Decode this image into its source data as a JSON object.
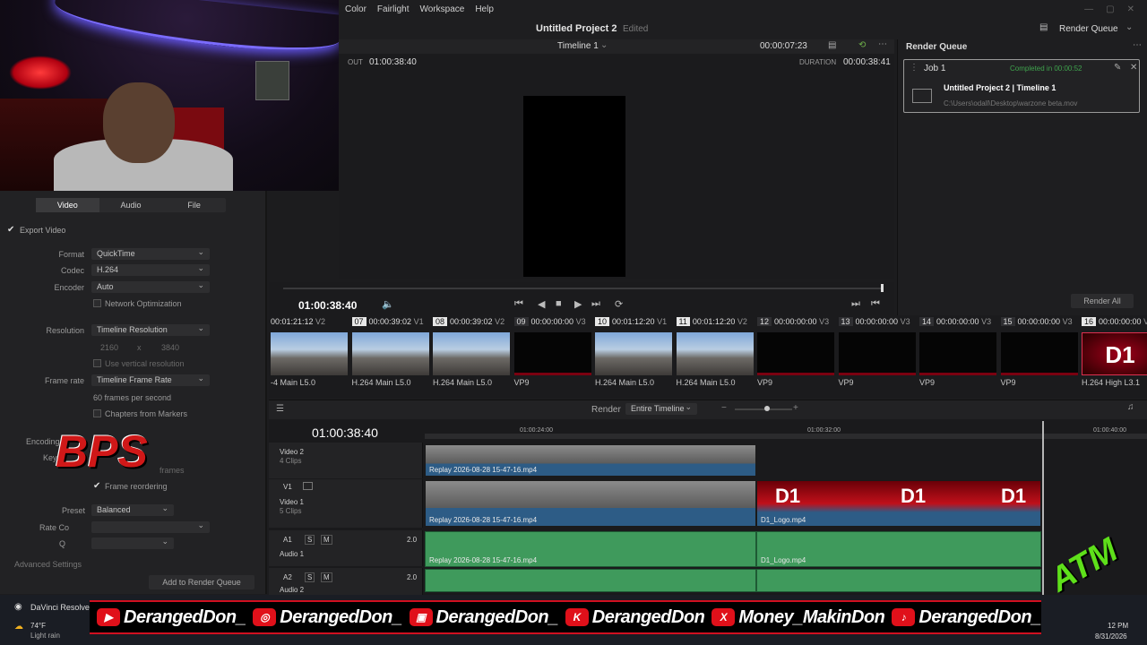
{
  "menu": {
    "items": [
      "Color",
      "Fairlight",
      "Workspace",
      "Help"
    ]
  },
  "header": {
    "project_title": "Untitled Project 2",
    "edited": "Edited",
    "render_queue_label": "Render Queue"
  },
  "viewer": {
    "timeline_name": "Timeline 1",
    "timecode_top": "00:00:07:23",
    "out_label": "OUT",
    "out_tc": "01:00:38:40",
    "duration_label": "DURATION",
    "duration_tc": "00:00:38:41",
    "current_tc": "01:00:38:40"
  },
  "render_queue": {
    "title": "Render Queue",
    "job": {
      "name": "Job 1",
      "status": "Completed in 00:00:52",
      "title": "Untitled Project 2 | Timeline 1",
      "path": "C:\\Users\\odall\\Desktop\\warzone beta.mov"
    },
    "render_all": "Render All"
  },
  "settings": {
    "tabs": [
      "Video",
      "Audio",
      "File"
    ],
    "export_video": "Export Video",
    "format_label": "Format",
    "format": "QuickTime",
    "codec_label": "Codec",
    "codec": "H.264",
    "encoder_label": "Encoder",
    "encoder": "Auto",
    "network_opt": "Network Optimization",
    "resolution_label": "Resolution",
    "resolution": "Timeline Resolution",
    "res_w": "2160",
    "res_x": "x",
    "res_h": "3840",
    "use_vertical": "Use vertical resolution",
    "framerate_label": "Frame rate",
    "framerate": "Timeline Frame Rate",
    "fps_text": "60 frames per second",
    "chapters": "Chapters from Markers",
    "encoding_label": "Encoding",
    "key_label": "Key F",
    "frames": "frames",
    "frame_reordering": "Frame reordering",
    "preset_label": "Preset",
    "preset": "Balanced",
    "rate_label": "Rate Co",
    "q_label": "Q",
    "advanced": "Advanced Settings",
    "add_to_queue": "Add to Render Queue"
  },
  "strip": {
    "clips": [
      {
        "num": "",
        "tc": "00:01:21:12",
        "trk": "V2",
        "cap": "-4 Main L5.0",
        "kind": "game"
      },
      {
        "num": "07",
        "tc": "00:00:39:02",
        "trk": "V1",
        "cap": "H.264 Main L5.0",
        "kind": "game"
      },
      {
        "num": "08",
        "tc": "00:00:39:02",
        "trk": "V2",
        "cap": "H.264 Main L5.0",
        "kind": "game"
      },
      {
        "num": "09",
        "tc": "00:00:00:00",
        "trk": "V3",
        "cap": "VP9",
        "kind": "blk"
      },
      {
        "num": "10",
        "tc": "00:01:12:20",
        "trk": "V1",
        "cap": "H.264 Main L5.0",
        "kind": "game"
      },
      {
        "num": "11",
        "tc": "00:01:12:20",
        "trk": "V2",
        "cap": "H.264 Main L5.0",
        "kind": "game"
      },
      {
        "num": "12",
        "tc": "00:00:00:00",
        "trk": "V3",
        "cap": "VP9",
        "kind": "blk"
      },
      {
        "num": "13",
        "tc": "00:00:00:00",
        "trk": "V3",
        "cap": "VP9",
        "kind": "blk"
      },
      {
        "num": "14",
        "tc": "00:00:00:00",
        "trk": "V3",
        "cap": "VP9",
        "kind": "blk"
      },
      {
        "num": "15",
        "tc": "00:00:00:00",
        "trk": "V3",
        "cap": "VP9",
        "kind": "blk"
      },
      {
        "num": "16",
        "tc": "00:00:00:00",
        "trk": "V1",
        "cap": "H.264 High L3.1",
        "kind": "d1"
      }
    ],
    "d1_text": "D1"
  },
  "timeline": {
    "render_label": "Render",
    "render_scope": "Entire Timeline",
    "tc": "01:00:38:40",
    "ruler": [
      "01:00:24:00",
      "01:00:32:00",
      "01:00:40:00"
    ],
    "tracks": {
      "v2_name": "Video 2",
      "v2_clips": "4 Clips",
      "v1_id": "V1",
      "v1_name": "Video 1",
      "v1_clips": "5 Clips",
      "a1_id": "A1",
      "a1_name": "Audio 1",
      "a1_vol": "2.0",
      "a2_id": "A2",
      "a2_name": "Audio 2",
      "a2_vol": "2.0",
      "s": "S",
      "m": "M"
    },
    "clip_replay": "Replay 2026-08-28 15-47-16.mp4",
    "clip_logo": "D1_Logo.mp4",
    "d1": "D1"
  },
  "overlay": {
    "items": [
      {
        "icon": "▶",
        "text": "DerangedDon_"
      },
      {
        "icon": "◎",
        "text": "DerangedDon_"
      },
      {
        "icon": "▣",
        "text": "DerangedDon_"
      },
      {
        "icon": "K",
        "text": "DerangedDon"
      },
      {
        "icon": "X",
        "text": "Money_MakinDon"
      },
      {
        "icon": "♪",
        "text": "DerangedDon_"
      }
    ],
    "bps": "BPS",
    "atm": "ATM"
  },
  "taskbar": {
    "app": "DaVinci Resolve",
    "temp": "74°F",
    "weather": "Light rain",
    "time": "12 PM",
    "date": "8/31/2026"
  }
}
